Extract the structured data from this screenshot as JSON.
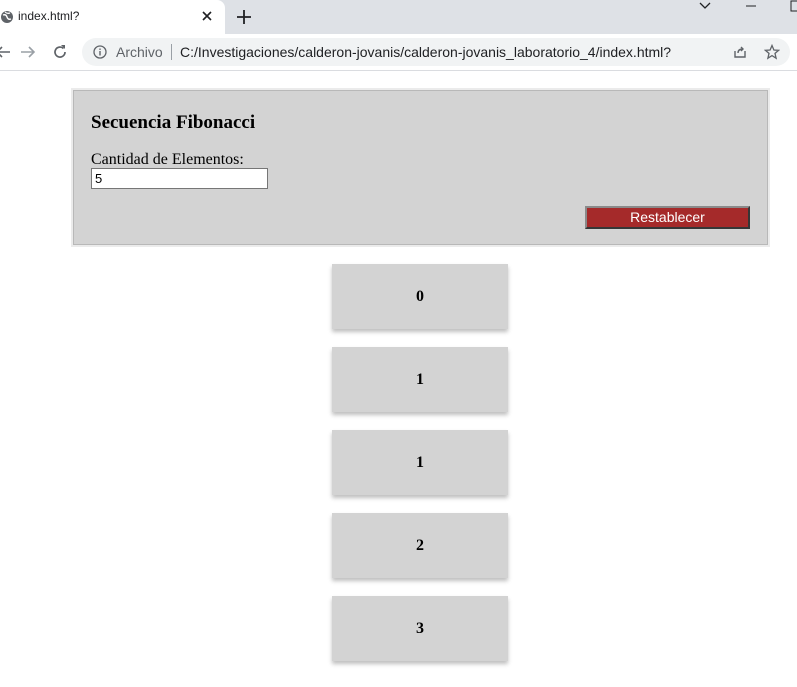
{
  "browser": {
    "tab_title": "index.html?",
    "omnibox_label": "Archivo",
    "url": "C:/Investigaciones/calderon-jovanis/calderon-jovanis_laboratorio_4/index.html?"
  },
  "page": {
    "title": "Secuencia Fibonacci",
    "count_label": "Cantidad de Elementos:",
    "count_value": "5",
    "reset_label": "Restablecer",
    "sequence": [
      "0",
      "1",
      "1",
      "2",
      "3"
    ]
  },
  "colors": {
    "panel_bg": "#d3d3d3",
    "reset_button_bg": "#a52a2a"
  }
}
